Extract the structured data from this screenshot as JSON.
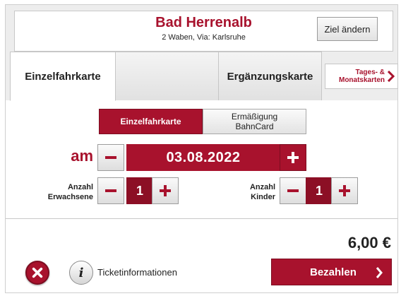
{
  "header": {
    "destination": "Bad Herrenalb",
    "subtitle": "2 Waben, Via: Karlsruhe",
    "change_destination_label": "Ziel ändern"
  },
  "tabs": [
    {
      "label": "Einzelfahrkarte",
      "active": true
    },
    {
      "label": "",
      "active": false
    },
    {
      "label": "Ergänzungskarte",
      "active": false
    },
    {
      "label_line1": "Tages- &",
      "label_line2": "Monatskarten",
      "active": false
    }
  ],
  "ticket_type": {
    "selected_label": "Einzelfahrkarte",
    "alternative_line1": "Ermäßigung",
    "alternative_line2": "BahnCard"
  },
  "date": {
    "label": "am",
    "value": "03.08.2022"
  },
  "quantities": {
    "adults": {
      "label_line1": "Anzahl",
      "label_line2": "Erwachsene",
      "value": "1"
    },
    "children": {
      "label_line1": "Anzahl",
      "label_line2": "Kinder",
      "value": "1"
    }
  },
  "footer": {
    "price": "6,00 €",
    "info_label": "Ticketinformationen",
    "info_icon_glyph": "i",
    "pay_label": "Bezahlen"
  },
  "colors": {
    "accent": "#a8122d",
    "accent_dark": "#7d0d21"
  },
  "icons": {
    "minus": "minus-icon",
    "plus": "plus-icon",
    "chevron": "chevron-right-icon",
    "close": "close-icon",
    "info": "info-icon"
  }
}
